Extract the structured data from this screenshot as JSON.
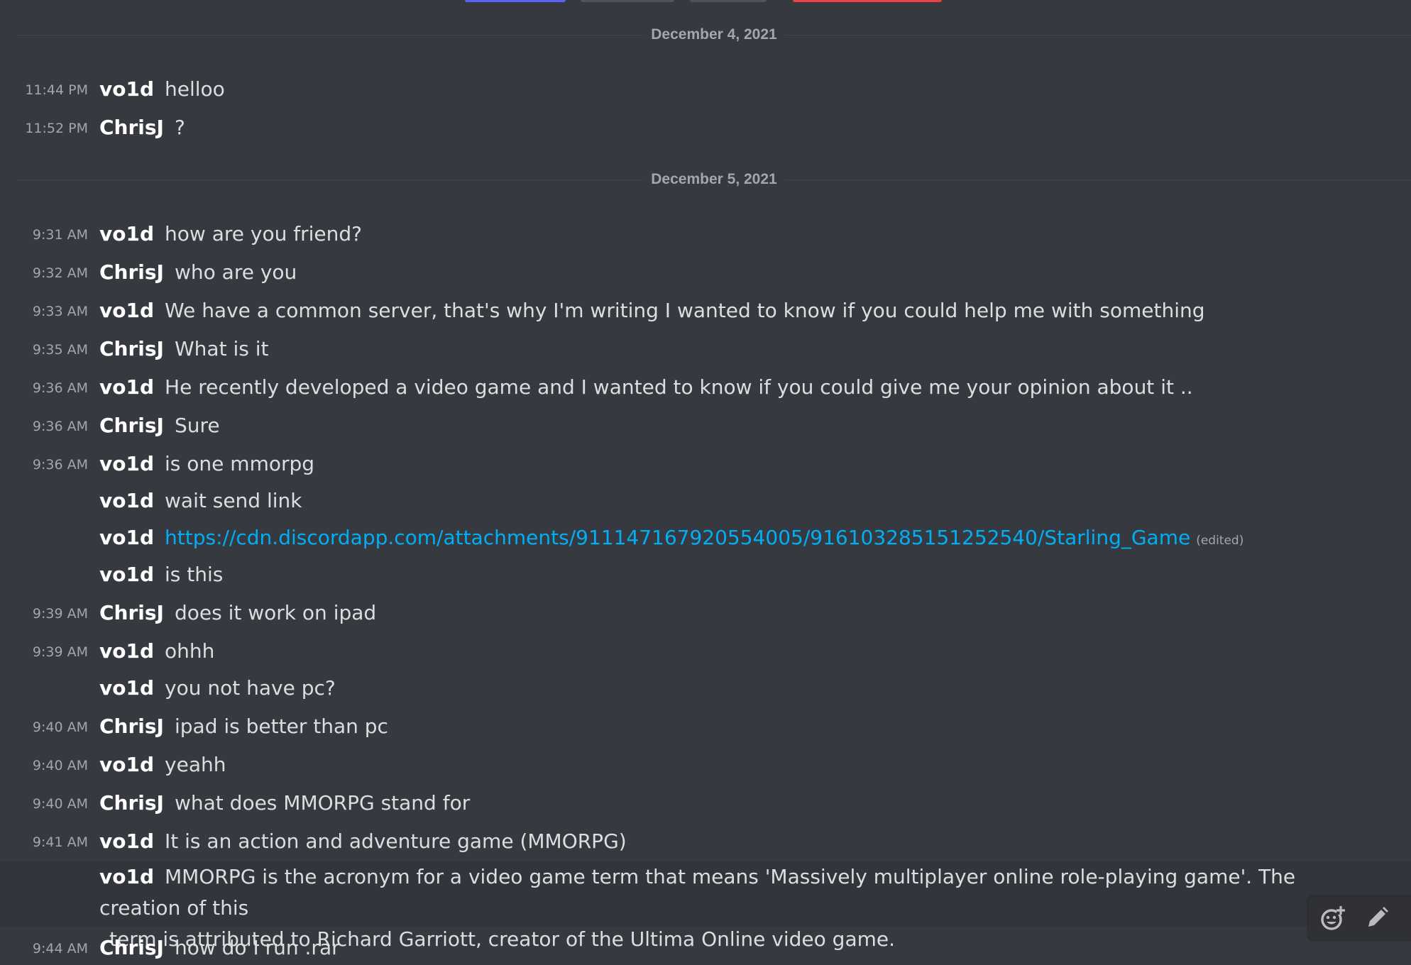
{
  "dates": [
    "December 4, 2021",
    "December 5, 2021"
  ],
  "messages": [
    {
      "time": "11:44 PM",
      "user": "vo1d",
      "text": "helloo"
    },
    {
      "time": "11:52 PM",
      "user": "ChrisJ",
      "text": "?"
    },
    {
      "time": "9:31 AM",
      "user": "vo1d",
      "text": "how are you friend?"
    },
    {
      "time": "9:32 AM",
      "user": "ChrisJ",
      "text": "who are you"
    },
    {
      "time": "9:33 AM",
      "user": "vo1d",
      "text": "We have a common server, that's why I'm writing I wanted to know if you could help me with something"
    },
    {
      "time": "9:35 AM",
      "user": "ChrisJ",
      "text": "What is it"
    },
    {
      "time": "9:36 AM",
      "user": "vo1d",
      "text": "He recently developed a video game and I wanted to know if you could give me your opinion about it .."
    },
    {
      "time": "9:36 AM",
      "user": "ChrisJ",
      "text": "Sure"
    },
    {
      "time": "9:36 AM",
      "user": "vo1d",
      "text": "is one mmorpg"
    },
    {
      "time": "",
      "user": "vo1d",
      "text": "wait send link"
    },
    {
      "time": "",
      "user": "vo1d",
      "link": "https://cdn.discordapp.com/attachments/911147167920554005/916103285151252540/Starling_Game",
      "edited": "(edited)"
    },
    {
      "time": "",
      "user": "vo1d",
      "text": "is this"
    },
    {
      "time": "9:39 AM",
      "user": "ChrisJ",
      "text": "does it work on ipad"
    },
    {
      "time": "9:39 AM",
      "user": "vo1d",
      "text": "ohhh"
    },
    {
      "time": "",
      "user": "vo1d",
      "text": "you not have pc?"
    },
    {
      "time": "9:40 AM",
      "user": "ChrisJ",
      "text": "ipad is better than pc"
    },
    {
      "time": "9:40 AM",
      "user": "vo1d",
      "text": "yeahh"
    },
    {
      "time": "9:40 AM",
      "user": "ChrisJ",
      "text": "what does MMORPG stand for"
    },
    {
      "time": "9:41 AM",
      "user": "vo1d",
      "text": "It is an action and adventure game (MMORPG)"
    },
    {
      "time": "",
      "user": "vo1d",
      "text": "MMORPG is the acronym for a video game term that means 'Massively multiplayer online role-playing game'. The creation of this",
      "text_cont": "term is attributed to Richard Garriott, creator of the Ultima Online video game."
    },
    {
      "time": "9:44 AM",
      "user": "ChrisJ",
      "text": "how do I run .rar"
    }
  ],
  "hover_actions": {
    "react_icon": "add-reaction-icon",
    "edit_icon": "pencil-edit-icon"
  },
  "colors": {
    "background": "#36393f",
    "link": "#00aff4",
    "username": "#ffffff",
    "text": "#dcddde",
    "timestamp": "#a3a6aa"
  }
}
